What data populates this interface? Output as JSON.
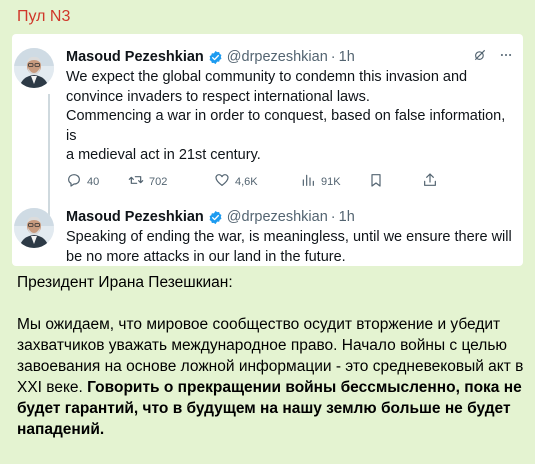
{
  "channel": {
    "title": "Пул N3"
  },
  "tweets": [
    {
      "name": "Masoud Pezeshkian",
      "handle": "@drpezeshkian",
      "separator": "·",
      "time": "1h",
      "lines": [
        "We expect the global community to condemn this invasion and",
        "convince invaders to respect international laws.",
        "Commencing a war in order to conquest, based on false information, is",
        "a medieval act in 21st century."
      ],
      "stats": {
        "replies": "40",
        "retweets": "702",
        "likes": "4,6K",
        "views": "91K"
      }
    },
    {
      "name": "Masoud Pezeshkian",
      "handle": "@drpezeshkian",
      "separator": "·",
      "time": "1h",
      "lines": [
        "Speaking of ending the war, is meaningless, until we ensure there will",
        "be no more attacks in our land in the future."
      ]
    }
  ],
  "message": {
    "heading": "Президент Ирана Пезешкиан:",
    "normal": "Мы ожидаем, что мировое сообщество осудит вторжение и убедит захватчиков уважать международное право. Начало войны с целью завоевания на основе ложной информации - это средневековый акт в XXI веке.",
    "bold": "Говорить о прекращении войны бессмысленно, пока не будет гарантий, что в будущем на нашу землю больше не будет нападений."
  },
  "icons": [
    "verified-badge-icon",
    "grok-icon",
    "more-icon",
    "reply-icon",
    "retweet-icon",
    "like-icon",
    "views-icon",
    "bookmark-icon",
    "share-icon"
  ],
  "colors": {
    "background": "#e4f3d1",
    "channel_title": "#d0372a",
    "verified": "#1d9bf0",
    "muted": "#536471"
  }
}
